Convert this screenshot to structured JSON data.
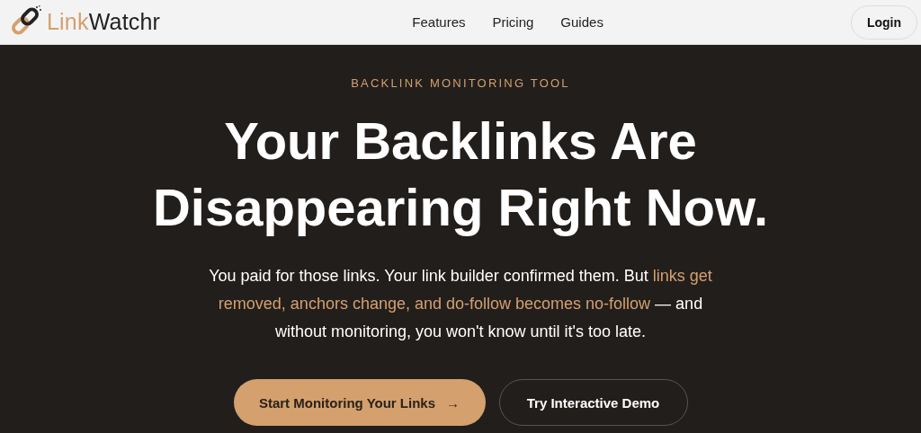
{
  "header": {
    "logo": {
      "accent": "Link",
      "rest": "Watchr"
    },
    "nav": [
      "Features",
      "Pricing",
      "Guides"
    ],
    "login": "Login"
  },
  "hero": {
    "eyebrow": "BACKLINK MONITORING TOOL",
    "headline": [
      "Your Backlinks Are",
      "Disappearing Right Now."
    ],
    "description": "You paid for those links. Your link builder confirmed them. But **links get removed, anchors change, and do-follow becomes no-follow** — and without monitoring, you won't know until it's too late.",
    "buttons": [
      {
        "kind": "primary",
        "label": "Start Monitoring Your Links",
        "arrow": "→"
      },
      {
        "kind": "secondary",
        "label": "Try Interactive Demo"
      }
    ]
  }
}
